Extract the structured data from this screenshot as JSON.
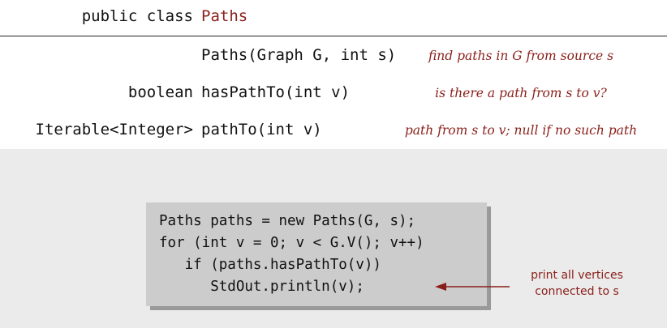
{
  "header": {
    "keywords": "public class",
    "class_name": "Paths"
  },
  "api_rows": [
    {
      "return_type": "",
      "signature": "Paths(Graph G, int s)",
      "description": "find paths in G from source s"
    },
    {
      "return_type": "boolean",
      "signature": "hasPathTo(int v)",
      "description": "is there a path from s to v?"
    },
    {
      "return_type": "Iterable<Integer>",
      "signature": "pathTo(int v)",
      "description": "path from s to v; null if no such path"
    }
  ],
  "client_code": {
    "lines": [
      "Paths paths = new Paths(G, s);",
      "for (int v = 0; v < G.V(); v++)",
      "   if (paths.hasPathTo(v))",
      "      StdOut.println(v);"
    ]
  },
  "annotation": {
    "line1": "print all vertices",
    "line2": "connected to s"
  },
  "colors": {
    "accent": "#8a1f1a",
    "code_background": "#cccccc",
    "page_background": "#ebebeb"
  }
}
